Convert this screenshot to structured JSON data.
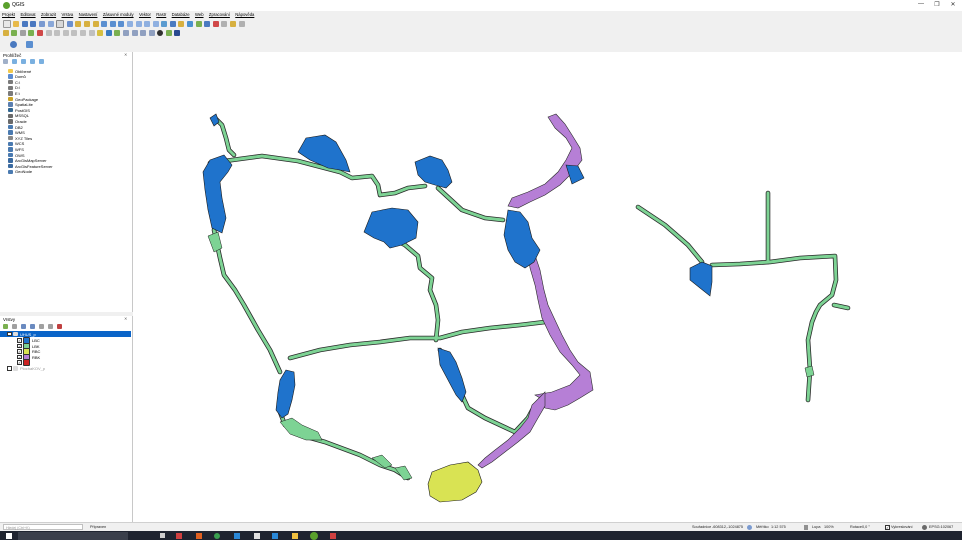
{
  "window": {
    "title": "QGIS",
    "controls": [
      "—",
      "❐",
      "✕"
    ]
  },
  "menubar": [
    "Projekt",
    "Editovat",
    "Zobrazit",
    "Vrstva",
    "Nastavení",
    "Zásuvné moduly",
    "Vektor",
    "Rastr",
    "Databáze",
    "Web",
    "Zpracování",
    "Nápověda"
  ],
  "browser": {
    "title": "Prohlížeč",
    "items": [
      "Oblíbené",
      "Domů",
      "C:\\",
      "D:\\",
      "E:\\",
      "GeoPackage",
      "SpatiaLite",
      "PostGIS",
      "MSSQL",
      "Oracle",
      "DB2",
      "WMS",
      "XYZ Tiles",
      "WCS",
      "WFS",
      "OWS",
      "ArcGisMapServer",
      "ArcGisFeatureServer",
      "GeoNode"
    ],
    "item_colors": [
      "#f2c94c",
      "#5b8bd0",
      "#7a7a7a",
      "#7a7a7a",
      "#7a7a7a",
      "#c9a227",
      "#5b7fb0",
      "#336791",
      "#6a6a6a",
      "#6a6a6a",
      "#4a7ab0",
      "#4a7ab0",
      "#888888",
      "#4a7ab0",
      "#4a7ab0",
      "#4a7ab0",
      "#3a6aa0",
      "#3a6aa0",
      "#4a7ab0"
    ]
  },
  "layers": {
    "title": "Vrstvy",
    "group": "UHUS_p",
    "classes": [
      {
        "label": "LBC",
        "color": "#1f73cc"
      },
      {
        "label": "LBK",
        "color": "#7dd394"
      },
      {
        "label": "RBC",
        "color": "#d9e353"
      },
      {
        "label": "RBK",
        "color": "#b67fd6"
      },
      {
        "label": "",
        "color": "#cc2222"
      }
    ],
    "second_layer": "PlochaKOV_p"
  },
  "map": {
    "colors": {
      "lbc": "#1f73cc",
      "lbk": "#7dd394",
      "rbc": "#d9e353",
      "rbk": "#b67fd6",
      "outline": "#2a2a2a"
    }
  },
  "statusbar": {
    "search_placeholder": "Hledej (Ctrl+K)",
    "ready": "Připraven",
    "coordinate_label": "Souřadnice",
    "coordinate": "-608312,-1024875",
    "scale_label": "Měřítko",
    "scale": "1:12 575",
    "magnifier_label": "Lupa",
    "magnifier": "100%",
    "rotation_label": "Rotace",
    "rotation": "0,0 °",
    "render_label": "Vykreslování",
    "crs": "EPSG:102067"
  }
}
